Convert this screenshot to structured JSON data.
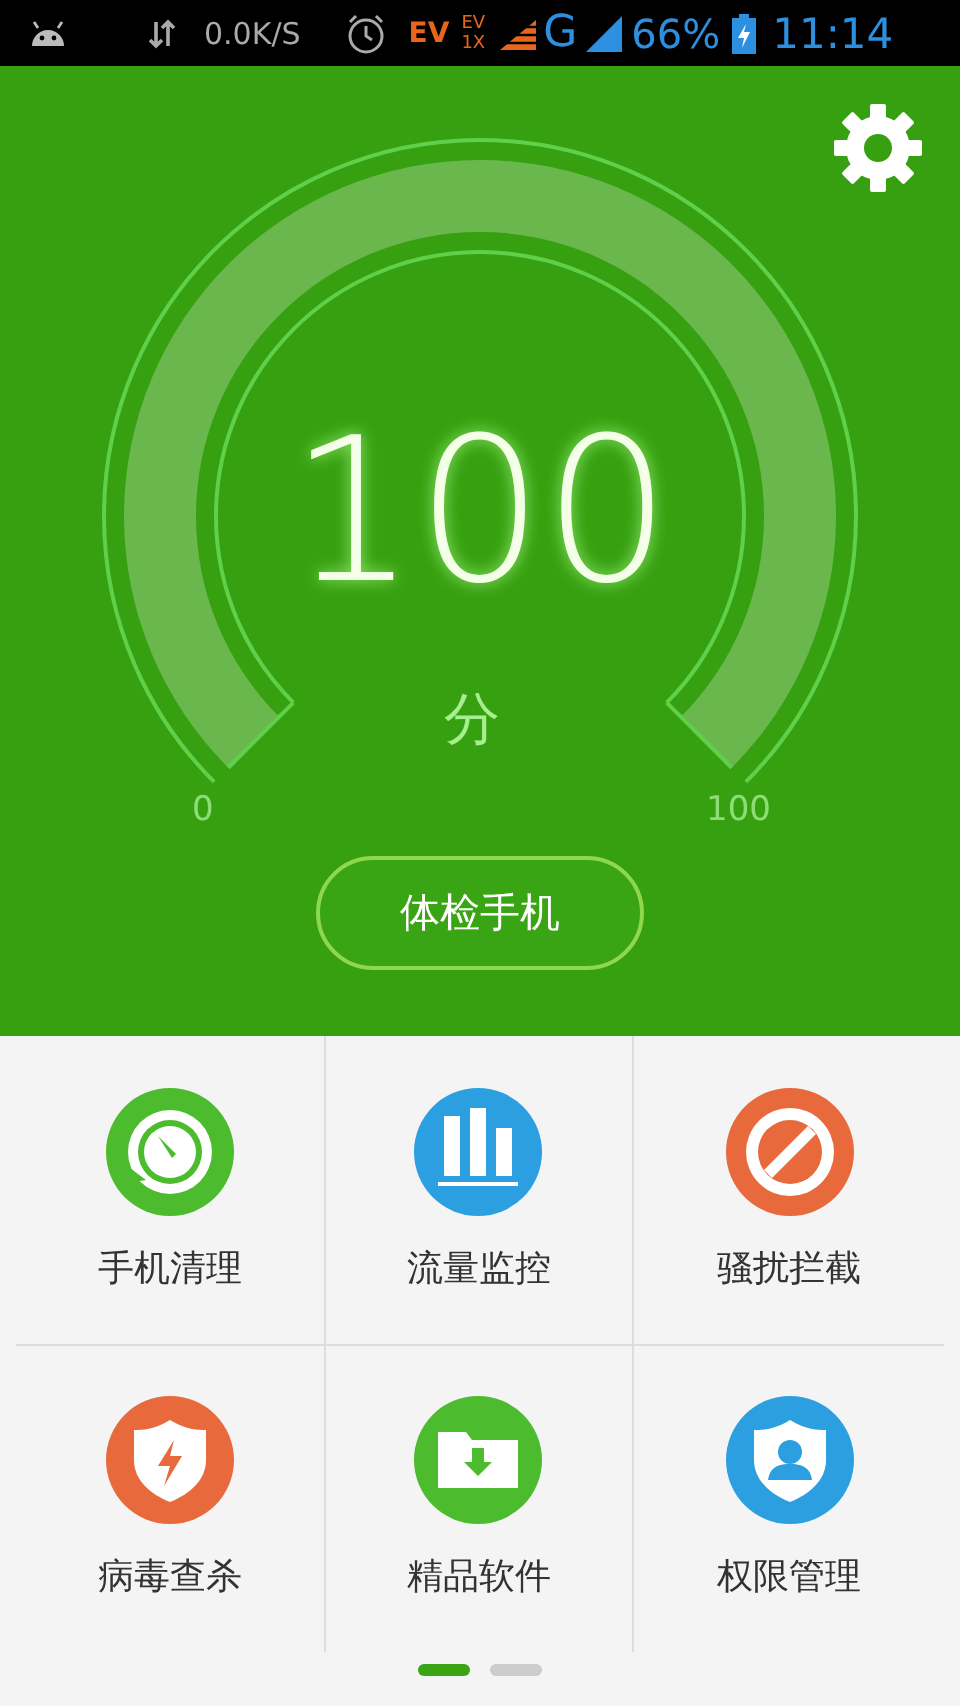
{
  "status_bar": {
    "speed": "0.0K/S",
    "ev": "EV",
    "ev_1x": [
      "EV",
      "1X"
    ],
    "network": "G",
    "battery": "66%",
    "time": "11:14"
  },
  "gauge": {
    "score": "100",
    "unit": "分",
    "min_label": "0",
    "max_label": "100"
  },
  "check_button": "体检手机",
  "tools": [
    {
      "label": "手机清理",
      "kind": "speedometer",
      "color": "#4cbb2e"
    },
    {
      "label": "流量监控",
      "kind": "bars",
      "color": "#2c9fe0"
    },
    {
      "label": "骚扰拦截",
      "kind": "block",
      "color": "#e8693c"
    },
    {
      "label": "病毒查杀",
      "kind": "shield-bolt",
      "color": "#e8693c"
    },
    {
      "label": "精品软件",
      "kind": "folder-download",
      "color": "#4cbb2e"
    },
    {
      "label": "权限管理",
      "kind": "shield-person",
      "color": "#2c9fe0"
    }
  ],
  "pages": [
    {
      "selected": true
    },
    {
      "selected": false
    }
  ]
}
